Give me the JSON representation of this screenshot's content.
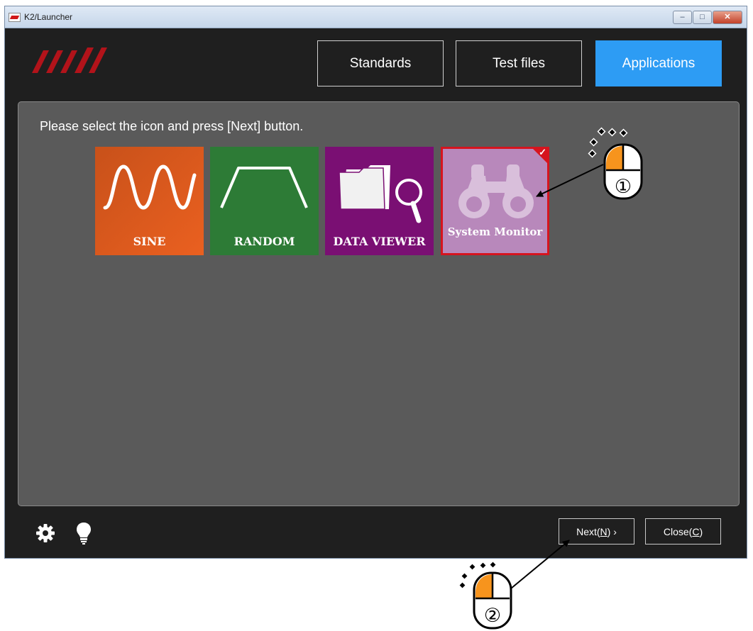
{
  "window": {
    "title": "K2/Launcher"
  },
  "tabs": [
    {
      "label": "Standards",
      "active": false
    },
    {
      "label": "Test files",
      "active": false
    },
    {
      "label": "Applications",
      "active": true
    }
  ],
  "main": {
    "instruction": "Please select the icon and press [Next] button.",
    "tiles": [
      {
        "label": "SINE",
        "icon": "sine-wave-icon",
        "color": "#e05a1e",
        "selected": false
      },
      {
        "label": "RANDOM",
        "icon": "trapezoid-icon",
        "color": "#2d7b36",
        "selected": false
      },
      {
        "label": "DATA VIEWER",
        "icon": "folder-magnifier-icon",
        "color": "#7a0f73",
        "selected": false
      },
      {
        "label": "System Monitor",
        "icon": "binoculars-icon",
        "color": "#b888bb",
        "selected": true
      }
    ]
  },
  "footer": {
    "next": {
      "prefix": "Next(",
      "key": "N",
      "suffix": ") ›"
    },
    "close": {
      "prefix": "Close(",
      "key": "C",
      "suffix": ")"
    }
  },
  "annotations": [
    {
      "label": "①"
    },
    {
      "label": "②"
    }
  ],
  "colors": {
    "accent": "#2d9cf4",
    "selection": "#d6141e",
    "panel": "#5a5a5a",
    "mouse_button": "#f7941d"
  }
}
